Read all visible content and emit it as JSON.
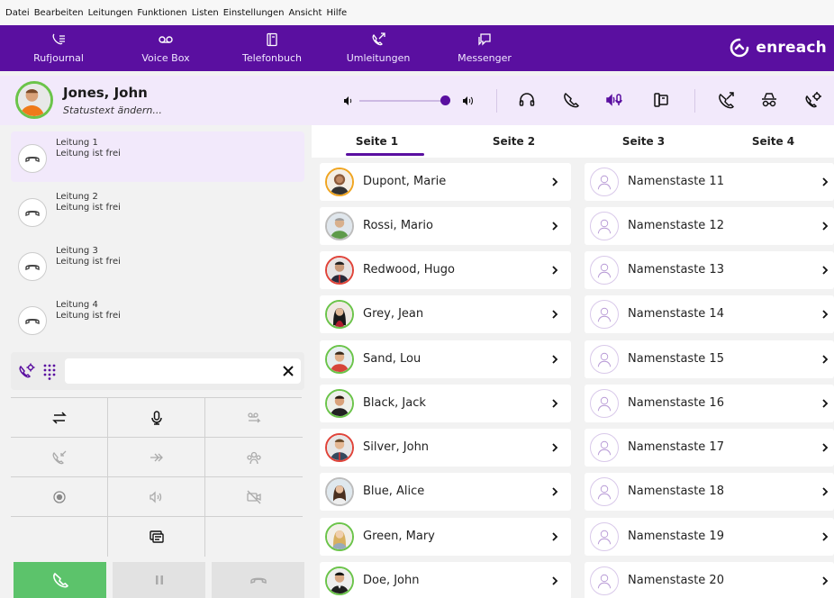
{
  "menu": [
    "Datei",
    "Bearbeiten",
    "Leitungen",
    "Funktionen",
    "Listen",
    "Einstellungen",
    "Ansicht",
    "Hilfe"
  ],
  "nav": [
    {
      "label": "Rufjournal",
      "icon": "call-journal-icon"
    },
    {
      "label": "Voice Box",
      "icon": "voicemail-icon"
    },
    {
      "label": "Telefonbuch",
      "icon": "phonebook-icon"
    },
    {
      "label": "Umleitungen",
      "icon": "call-forward-icon"
    },
    {
      "label": "Messenger",
      "icon": "messenger-icon"
    }
  ],
  "brand": {
    "name": "enreach",
    "color": "#5a0fa0"
  },
  "user": {
    "name": "Jones, John",
    "status": "Statustext ändern...",
    "volume_fraction": 0.95
  },
  "lines": [
    {
      "title": "Leitung 1",
      "status": "Leitung  ist frei",
      "active": true
    },
    {
      "title": "Leitung 2",
      "status": "Leitung  ist frei",
      "active": false
    },
    {
      "title": "Leitung 3",
      "status": "Leitung  ist frei",
      "active": false
    },
    {
      "title": "Leitung 4",
      "status": "Leitung  ist frei",
      "active": false
    }
  ],
  "dial": {
    "value": "",
    "placeholder": ""
  },
  "tabs": [
    "Seite 1",
    "Seite 2",
    "Seite 3",
    "Seite 4"
  ],
  "selected_tab": "Seite 1",
  "contacts_left": [
    "Dupont, Marie",
    "Rossi, Mario",
    "Redwood, Hugo",
    "Grey, Jean",
    "Sand, Lou",
    "Black, Jack",
    "Silver, John",
    "Blue, Alice",
    "Green, Mary",
    "Doe, John"
  ],
  "contacts_right": [
    "Namenstaste 11",
    "Namenstaste 12",
    "Namenstaste 13",
    "Namenstaste 14",
    "Namenstaste 15",
    "Namenstaste 16",
    "Namenstaste 17",
    "Namenstaste 18",
    "Namenstaste 19",
    "Namenstaste 20"
  ],
  "colors": {
    "accent": "#5a0fa0",
    "call_green": "#5cc36b",
    "available_ring": "#6bc44a",
    "busy_ring": "#e0443a",
    "away_ring": "#f0a521"
  }
}
